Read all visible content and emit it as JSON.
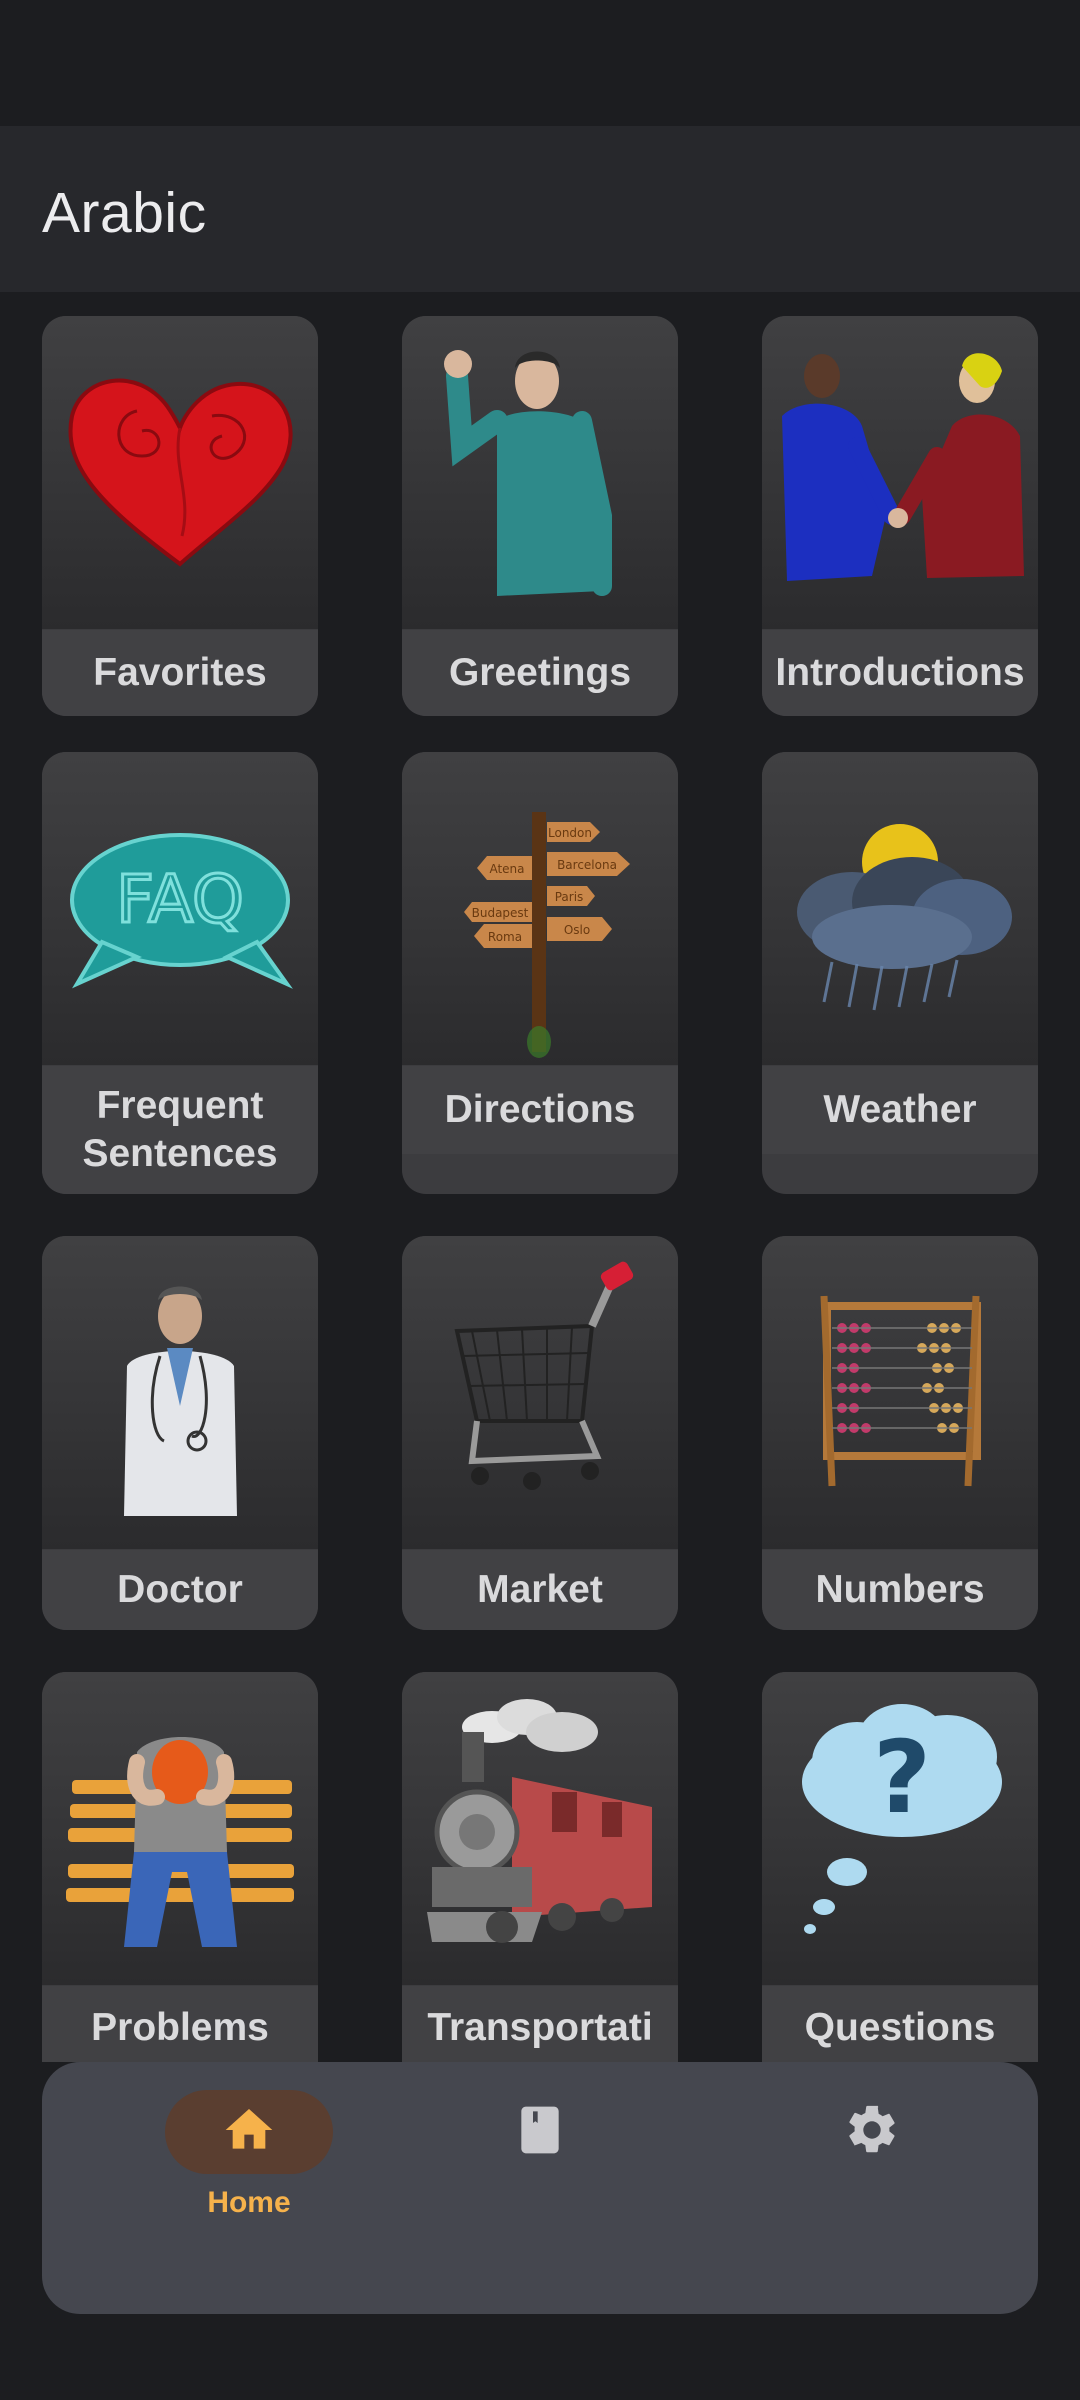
{
  "app": {
    "title": "Arabic"
  },
  "categories": [
    {
      "label": "Favorites",
      "icon": "heart-icon"
    },
    {
      "label": "Greetings",
      "icon": "waving-man-icon"
    },
    {
      "label": "Introductions",
      "icon": "handshake-icon"
    },
    {
      "label": "Frequent\nSentences",
      "icon": "faq-bubble-icon"
    },
    {
      "label": "Directions",
      "icon": "signpost-icon"
    },
    {
      "label": "Weather",
      "icon": "storm-cloud-sun-icon"
    },
    {
      "label": "Doctor",
      "icon": "doctor-icon"
    },
    {
      "label": "Market",
      "icon": "shopping-cart-icon"
    },
    {
      "label": "Numbers",
      "icon": "abacus-icon"
    },
    {
      "label": "Problems",
      "icon": "stressed-man-bench-icon"
    },
    {
      "label": "Transportati",
      "icon": "steam-train-icon"
    },
    {
      "label": "Questions",
      "icon": "question-cloud-icon"
    }
  ],
  "signpost_words": [
    "Atena",
    "London",
    "Barcelona",
    "Paris",
    "Budapest",
    "Roma",
    "Oslo"
  ],
  "faq_text": "FAQ",
  "nav": {
    "items": [
      {
        "label": "Home",
        "icon": "home-icon",
        "active": true
      },
      {
        "label": "",
        "icon": "book-icon",
        "active": false
      },
      {
        "label": "",
        "icon": "gear-icon",
        "active": false
      }
    ]
  },
  "colors": {
    "accent": "#f6b24b",
    "background": "#1c1d20",
    "card": "#3c3c3f",
    "nav": "#45474f"
  }
}
